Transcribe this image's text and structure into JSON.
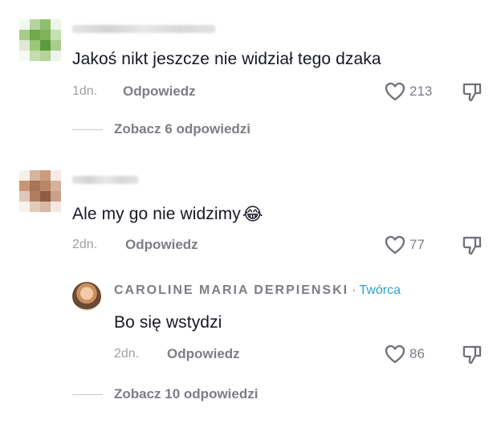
{
  "comments": [
    {
      "text": "Jakoś nikt jeszcze nie widział tego dzaka",
      "time": "1dn.",
      "reply_label": "Odpowiedz",
      "likes": "213",
      "view_replies": "Zobacz 6 odpowiedzi"
    },
    {
      "text": "Ale my go nie widzimy",
      "emoji": "😂",
      "time": "2dn.",
      "reply_label": "Odpowiedz",
      "likes": "77",
      "reply": {
        "author": "CAROLINE MARIA DERPIENSKI",
        "separator": "·",
        "badge": "Twórca",
        "text": "Bo się wstydzi",
        "time": "2dn.",
        "reply_label": "Odpowiedz",
        "likes": "86"
      },
      "view_replies": "Zobacz 10 odpowiedzi"
    }
  ],
  "icons": {
    "like": "heart-outline-icon",
    "dislike": "thumbs-down-icon"
  },
  "colors": {
    "text": "#161823",
    "muted": "#7d7d85",
    "creator_badge": "#2fa3c9"
  }
}
